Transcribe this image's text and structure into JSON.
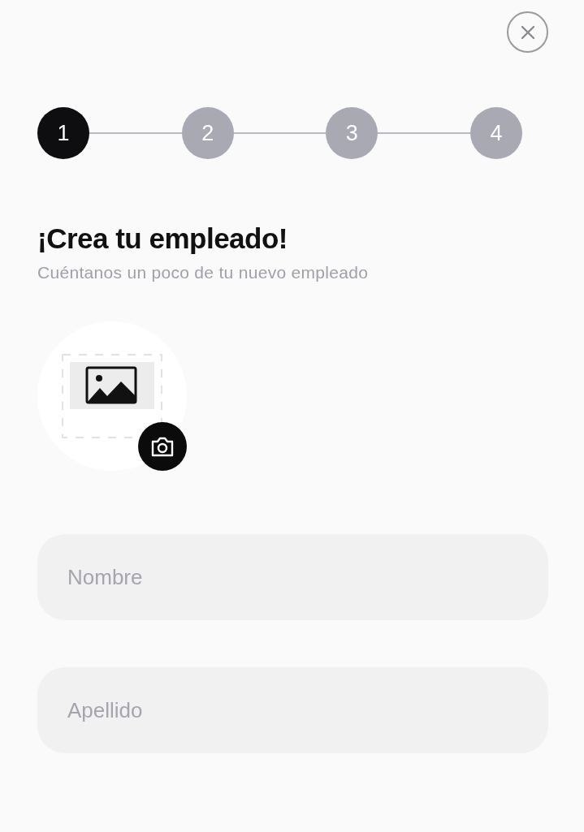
{
  "steps": [
    {
      "label": "1",
      "selected": true
    },
    {
      "label": "2",
      "selected": false
    },
    {
      "label": "3",
      "selected": false
    },
    {
      "label": "4",
      "selected": false
    }
  ],
  "title": "¡Crea tu empleado!",
  "subtitle": "Cuéntanos un poco de tu nuevo empleado",
  "fields": [
    {
      "placeholder": "Nombre"
    },
    {
      "placeholder": "Apellido"
    }
  ]
}
